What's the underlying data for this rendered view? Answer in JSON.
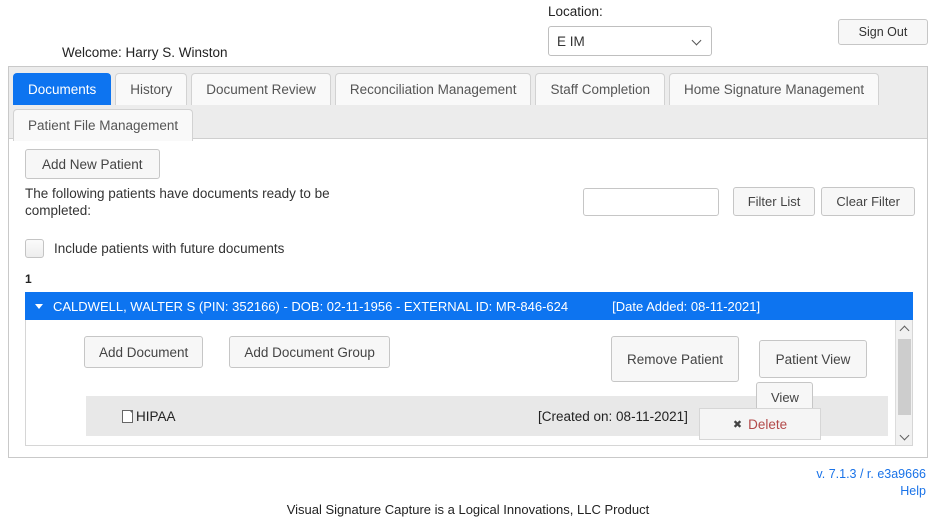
{
  "header": {
    "welcome": "Welcome: Harry S. Winston",
    "location_label": "Location:",
    "location_value": "E IM",
    "sign_out": "Sign Out"
  },
  "tabs": {
    "row1": [
      {
        "label": "Documents",
        "active": true
      },
      {
        "label": "History",
        "active": false
      },
      {
        "label": "Document Review",
        "active": false
      },
      {
        "label": "Reconciliation Management",
        "active": false
      },
      {
        "label": "Staff Completion",
        "active": false
      },
      {
        "label": "Home Signature Management",
        "active": false
      }
    ],
    "row2": [
      {
        "label": "Patient File Management",
        "active": false
      }
    ]
  },
  "toolbar": {
    "add_new_patient": "Add New Patient",
    "ready_text": "The following patients have documents ready to be completed:",
    "filter_value": "",
    "filter_placeholder": "",
    "filter_list": "Filter List",
    "clear_filter": "Clear Filter",
    "include_future_label": "Include patients with future documents",
    "include_future_checked": false,
    "result_count": "1"
  },
  "patient": {
    "title": "CALDWELL, WALTER S (PIN: 352166) - DOB: 02-11-1956 - EXTERNAL ID: MR-846-624",
    "date_added": "[Date Added: 08-11-2021]",
    "expanded": true,
    "actions": {
      "add_document": "Add Document",
      "add_document_group": "Add Document Group",
      "remove_patient": "Remove Patient",
      "patient_view": "Patient View"
    },
    "documents": [
      {
        "name": "HIPAA",
        "created": "[Created on: 08-11-2021]",
        "view_label": "View",
        "delete_label": "Delete"
      }
    ]
  },
  "footer": {
    "version": "v. 7.1.3 / r. e3a9666",
    "help": "Help",
    "product_note": "Visual Signature Capture is a Logical Innovations, LLC Product"
  },
  "colors": {
    "accent": "#0d74f0",
    "link": "#1a73e8",
    "delete": "#b34a4a"
  }
}
